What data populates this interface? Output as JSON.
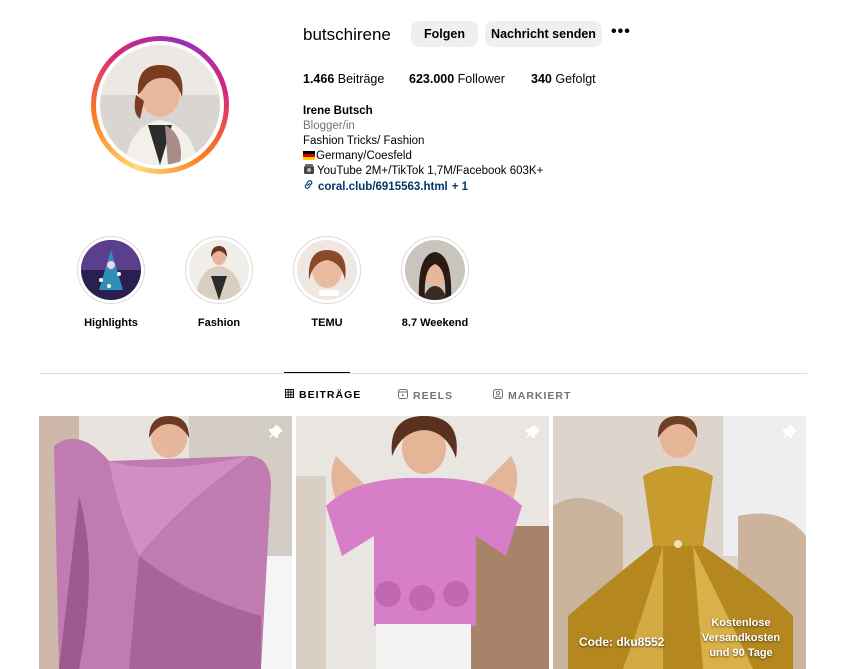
{
  "profile": {
    "username": "butschirene",
    "follow_label": "Folgen",
    "message_label": "Nachricht senden",
    "more_label": "•••",
    "posts_count": "1.466",
    "posts_label": "Beiträge",
    "followers_count": "623.000",
    "followers_label": "Follower",
    "following_count": "340",
    "following_label": "Gefolgt",
    "full_name": "Irene Butsch",
    "category": "Blogger/in",
    "bio_line1": "Fashion Tricks/ Fashion",
    "bio_line2": "Germany/Coesfeld",
    "bio_line3": "YouTube 2M+/TikTok 1,7M/Facebook 603K+",
    "link_text": "coral.club/6915563.html",
    "link_extra": "+ 1"
  },
  "highlights": [
    {
      "label": "Highlights"
    },
    {
      "label": "Fashion"
    },
    {
      "label": "TEMU"
    },
    {
      "label": "8.7 Weekend"
    }
  ],
  "tabs": [
    {
      "label": "BEITRÄGE",
      "icon": "grid-icon",
      "active": true
    },
    {
      "label": "REELS",
      "icon": "reels-icon",
      "active": false
    },
    {
      "label": "MARKIERT",
      "icon": "tagged-icon",
      "active": false
    }
  ],
  "posts": [
    {
      "pinned": true
    },
    {
      "pinned": true
    },
    {
      "pinned": true,
      "overlay_code": "Code: dku8552",
      "overlay_ship_1": "Kostenlose",
      "overlay_ship_2": "Versandkosten",
      "overlay_ship_3": "und 90 Tage"
    }
  ],
  "colors": {
    "button_bg": "#efefef",
    "link": "#00376b",
    "muted": "#737373",
    "divider": "#dbdbdb"
  }
}
